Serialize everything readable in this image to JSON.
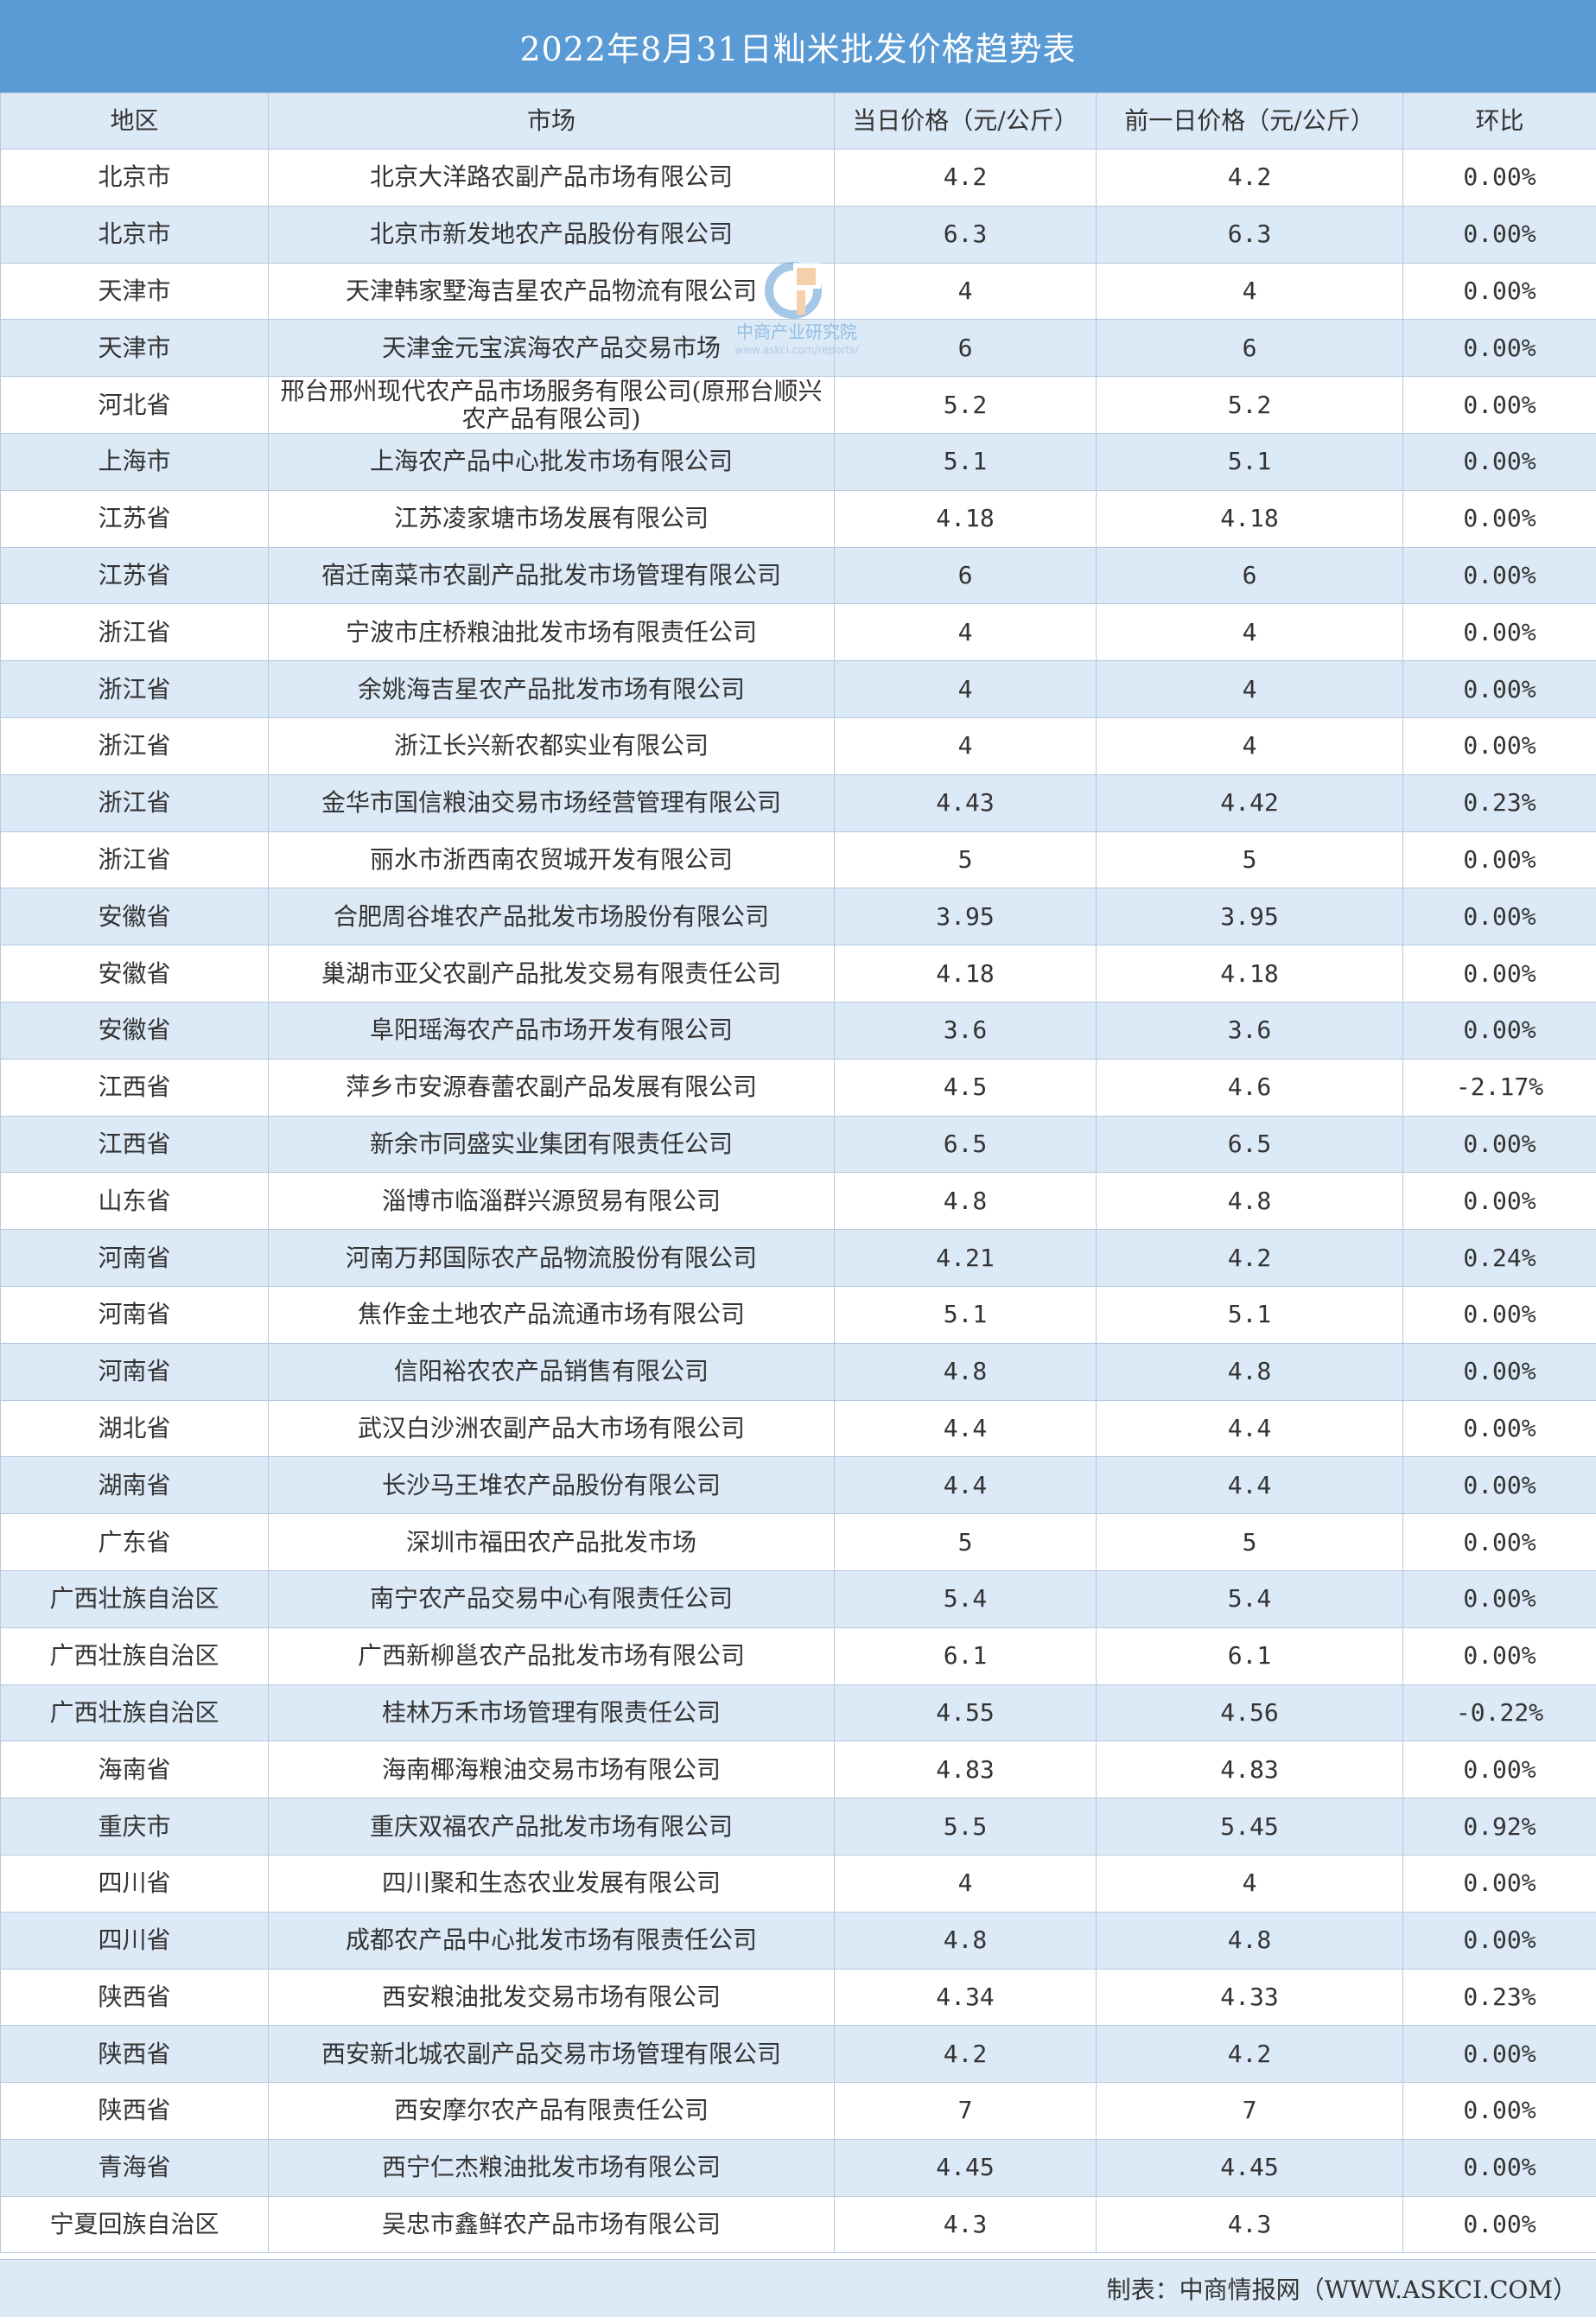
{
  "title": "2022年8月31日籼米批发价格趋势表",
  "chart_data": {
    "type": "table",
    "title": "2022年8月31日籼米批发价格趋势表",
    "columns": [
      "地区",
      "市场",
      "当日价格（元/公斤）",
      "前一日价格（元/公斤）",
      "环比"
    ],
    "rows": [
      {
        "region": "北京市",
        "market": "北京大洋路农副产品市场有限公司",
        "today": "4.2",
        "prev": "4.2",
        "ratio": "0.00%"
      },
      {
        "region": "北京市",
        "market": "北京市新发地农产品股份有限公司",
        "today": "6.3",
        "prev": "6.3",
        "ratio": "0.00%"
      },
      {
        "region": "天津市",
        "market": "天津韩家墅海吉星农产品物流有限公司",
        "today": "4",
        "prev": "4",
        "ratio": "0.00%"
      },
      {
        "region": "天津市",
        "market": "天津金元宝滨海农产品交易市场",
        "today": "6",
        "prev": "6",
        "ratio": "0.00%"
      },
      {
        "region": "河北省",
        "market": "邢台邢州现代农产品市场服务有限公司(原邢台顺兴农产品有限公司)",
        "today": "5.2",
        "prev": "5.2",
        "ratio": "0.00%"
      },
      {
        "region": "上海市",
        "market": "上海农产品中心批发市场有限公司",
        "today": "5.1",
        "prev": "5.1",
        "ratio": "0.00%"
      },
      {
        "region": "江苏省",
        "market": "江苏凌家塘市场发展有限公司",
        "today": "4.18",
        "prev": "4.18",
        "ratio": "0.00%"
      },
      {
        "region": "江苏省",
        "market": "宿迁南菜市农副产品批发市场管理有限公司",
        "today": "6",
        "prev": "6",
        "ratio": "0.00%"
      },
      {
        "region": "浙江省",
        "market": "宁波市庄桥粮油批发市场有限责任公司",
        "today": "4",
        "prev": "4",
        "ratio": "0.00%"
      },
      {
        "region": "浙江省",
        "market": "余姚海吉星农产品批发市场有限公司",
        "today": "4",
        "prev": "4",
        "ratio": "0.00%"
      },
      {
        "region": "浙江省",
        "market": "浙江长兴新农都实业有限公司",
        "today": "4",
        "prev": "4",
        "ratio": "0.00%"
      },
      {
        "region": "浙江省",
        "market": "金华市国信粮油交易市场经营管理有限公司",
        "today": "4.43",
        "prev": "4.42",
        "ratio": "0.23%"
      },
      {
        "region": "浙江省",
        "market": "丽水市浙西南农贸城开发有限公司",
        "today": "5",
        "prev": "5",
        "ratio": "0.00%"
      },
      {
        "region": "安徽省",
        "market": "合肥周谷堆农产品批发市场股份有限公司",
        "today": "3.95",
        "prev": "3.95",
        "ratio": "0.00%"
      },
      {
        "region": "安徽省",
        "market": "巢湖市亚父农副产品批发交易有限责任公司",
        "today": "4.18",
        "prev": "4.18",
        "ratio": "0.00%"
      },
      {
        "region": "安徽省",
        "market": "阜阳瑶海农产品市场开发有限公司",
        "today": "3.6",
        "prev": "3.6",
        "ratio": "0.00%"
      },
      {
        "region": "江西省",
        "market": "萍乡市安源春蕾农副产品发展有限公司",
        "today": "4.5",
        "prev": "4.6",
        "ratio": "-2.17%"
      },
      {
        "region": "江西省",
        "market": "新余市同盛实业集团有限责任公司",
        "today": "6.5",
        "prev": "6.5",
        "ratio": "0.00%"
      },
      {
        "region": "山东省",
        "market": "淄博市临淄群兴源贸易有限公司",
        "today": "4.8",
        "prev": "4.8",
        "ratio": "0.00%"
      },
      {
        "region": "河南省",
        "market": "河南万邦国际农产品物流股份有限公司",
        "today": "4.21",
        "prev": "4.2",
        "ratio": "0.24%"
      },
      {
        "region": "河南省",
        "market": "焦作金土地农产品流通市场有限公司",
        "today": "5.1",
        "prev": "5.1",
        "ratio": "0.00%"
      },
      {
        "region": "河南省",
        "market": "信阳裕农农产品销售有限公司",
        "today": "4.8",
        "prev": "4.8",
        "ratio": "0.00%"
      },
      {
        "region": "湖北省",
        "market": "武汉白沙洲农副产品大市场有限公司",
        "today": "4.4",
        "prev": "4.4",
        "ratio": "0.00%"
      },
      {
        "region": "湖南省",
        "market": "长沙马王堆农产品股份有限公司",
        "today": "4.4",
        "prev": "4.4",
        "ratio": "0.00%"
      },
      {
        "region": "广东省",
        "market": "深圳市福田农产品批发市场",
        "today": "5",
        "prev": "5",
        "ratio": "0.00%"
      },
      {
        "region": "广西壮族自治区",
        "market": "南宁农产品交易中心有限责任公司",
        "today": "5.4",
        "prev": "5.4",
        "ratio": "0.00%"
      },
      {
        "region": "广西壮族自治区",
        "market": "广西新柳邕农产品批发市场有限公司",
        "today": "6.1",
        "prev": "6.1",
        "ratio": "0.00%"
      },
      {
        "region": "广西壮族自治区",
        "market": "桂林万禾市场管理有限责任公司",
        "today": "4.55",
        "prev": "4.56",
        "ratio": "-0.22%"
      },
      {
        "region": "海南省",
        "market": "海南椰海粮油交易市场有限公司",
        "today": "4.83",
        "prev": "4.83",
        "ratio": "0.00%"
      },
      {
        "region": "重庆市",
        "market": "重庆双福农产品批发市场有限公司",
        "today": "5.5",
        "prev": "5.45",
        "ratio": "0.92%"
      },
      {
        "region": "四川省",
        "market": "四川聚和生态农业发展有限公司",
        "today": "4",
        "prev": "4",
        "ratio": "0.00%"
      },
      {
        "region": "四川省",
        "market": "成都农产品中心批发市场有限责任公司",
        "today": "4.8",
        "prev": "4.8",
        "ratio": "0.00%"
      },
      {
        "region": "陕西省",
        "market": "西安粮油批发交易市场有限公司",
        "today": "4.34",
        "prev": "4.33",
        "ratio": "0.23%"
      },
      {
        "region": "陕西省",
        "market": "西安新北城农副产品交易市场管理有限公司",
        "today": "4.2",
        "prev": "4.2",
        "ratio": "0.00%"
      },
      {
        "region": "陕西省",
        "market": "西安摩尔农产品有限责任公司",
        "today": "7",
        "prev": "7",
        "ratio": "0.00%"
      },
      {
        "region": "青海省",
        "market": "西宁仁杰粮油批发市场有限公司",
        "today": "4.45",
        "prev": "4.45",
        "ratio": "0.00%"
      },
      {
        "region": "宁夏回族自治区",
        "market": "吴忠市鑫鲜农产品市场有限公司",
        "today": "4.3",
        "prev": "4.3",
        "ratio": "0.00%"
      }
    ]
  },
  "watermark": {
    "text": "中商产业研究院",
    "url": "www.askci.com/reports/",
    "icon": "askci-logo-icon"
  },
  "footer": {
    "text": "制表：中商情报网（WWW.ASKCI.COM）"
  },
  "colors": {
    "header_blue": "#5b9bd5",
    "row_alt": "#dce9f6",
    "border": "#b7c9dc"
  }
}
